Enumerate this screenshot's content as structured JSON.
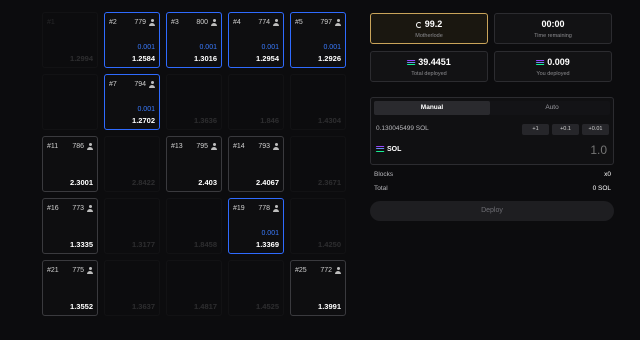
{
  "grid": {
    "cells": [
      {
        "num": "#1",
        "count": "",
        "mine": "",
        "total": "1.2994",
        "style": "faded"
      },
      {
        "num": "#2",
        "count": "779",
        "mine": "0.001",
        "total": "1.2584",
        "style": "sel"
      },
      {
        "num": "#3",
        "count": "800",
        "mine": "0.001",
        "total": "1.3016",
        "style": "sel"
      },
      {
        "num": "#4",
        "count": "774",
        "mine": "0.001",
        "total": "1.2954",
        "style": "sel"
      },
      {
        "num": "#5",
        "count": "797",
        "mine": "0.001",
        "total": "1.2926",
        "style": "sel"
      },
      {
        "num": "",
        "count": "",
        "mine": "",
        "total": "",
        "style": "faded"
      },
      {
        "num": "#7",
        "count": "794",
        "mine": "0.001",
        "total": "1.2702",
        "style": "sel"
      },
      {
        "num": "",
        "count": "",
        "mine": "",
        "total": "1.3636",
        "style": "faded"
      },
      {
        "num": "",
        "count": "",
        "mine": "",
        "total": "1.846",
        "style": "faded"
      },
      {
        "num": "",
        "count": "",
        "mine": "",
        "total": "1.4304",
        "style": "faded"
      },
      {
        "num": "#11",
        "count": "786",
        "mine": "",
        "total": "2.3001",
        "style": "plain"
      },
      {
        "num": "",
        "count": "",
        "mine": "",
        "total": "2.8422",
        "style": "faded"
      },
      {
        "num": "#13",
        "count": "795",
        "mine": "",
        "total": "2.403",
        "style": "plain"
      },
      {
        "num": "#14",
        "count": "793",
        "mine": "",
        "total": "2.4067",
        "style": "plain"
      },
      {
        "num": "",
        "count": "",
        "mine": "",
        "total": "2.3671",
        "style": "faded"
      },
      {
        "num": "#16",
        "count": "773",
        "mine": "",
        "total": "1.3335",
        "style": "plain"
      },
      {
        "num": "",
        "count": "",
        "mine": "",
        "total": "1.3177",
        "style": "faded"
      },
      {
        "num": "",
        "count": "",
        "mine": "",
        "total": "1.8458",
        "style": "faded"
      },
      {
        "num": "#19",
        "count": "778",
        "mine": "0.001",
        "total": "1.3369",
        "style": "sel"
      },
      {
        "num": "",
        "count": "",
        "mine": "",
        "total": "1.4250",
        "style": "faded"
      },
      {
        "num": "#21",
        "count": "775",
        "mine": "",
        "total": "1.3552",
        "style": "plain"
      },
      {
        "num": "",
        "count": "",
        "mine": "",
        "total": "1.3637",
        "style": "faded"
      },
      {
        "num": "",
        "count": "",
        "mine": "",
        "total": "1.4817",
        "style": "faded"
      },
      {
        "num": "",
        "count": "",
        "mine": "",
        "total": "1.4525",
        "style": "faded"
      },
      {
        "num": "#25",
        "count": "772",
        "mine": "",
        "total": "1.3991",
        "style": "plain"
      }
    ]
  },
  "stats": {
    "motherlode": {
      "value": "99.2",
      "label": "Motherlode"
    },
    "time": {
      "value": "00:00",
      "label": "Time remaining"
    },
    "total_deployed": {
      "value": "39.4451",
      "label": "Total deployed"
    },
    "you_deployed": {
      "value": "0.009",
      "label": "You deployed"
    }
  },
  "deploy": {
    "tabs": [
      "Manual",
      "Auto"
    ],
    "balance": "0.130045499 SOL",
    "quick": [
      "+1",
      "+0.1",
      "+0.01"
    ],
    "token": "SOL",
    "amount_placeholder": "1.0"
  },
  "summary": {
    "blocks_label": "Blocks",
    "blocks_value": "x0",
    "total_label": "Total",
    "total_value": "0 SOL"
  },
  "action": {
    "deploy_label": "Deploy"
  },
  "colors": {
    "accent": "#2f6bff",
    "gold": "#c9a45a",
    "background": "#0c0c0e"
  },
  "icons": {
    "motherlode": "refresh-icon",
    "sol": "solana-icon",
    "miners": "person-icon"
  }
}
